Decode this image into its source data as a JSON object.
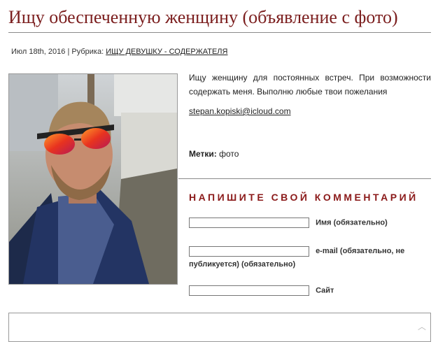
{
  "post": {
    "title": "Ищу обеспеченную женщину (объявление с фото)",
    "date": "Июл 18th, 2016",
    "separator": "|",
    "category_label": "Рубрика:",
    "category_link": "ИЩУ ДЕВУШКУ - СОДЕРЖАТЕЛЯ",
    "body": "Ищу женщину для постоянных встреч. При возможности содержать меня. Выполню любые твои пожелания",
    "email": "stepan.kopiski@icloud.com",
    "tags_label": "Метки:",
    "tags": "фото"
  },
  "comments": {
    "heading": "НАПИШИТЕ СВОЙ КОММЕНТАРИЙ",
    "name_label": "Имя (обязательно)",
    "email_label": "e-mail (обязательно, не публикуется) (обязательно)",
    "site_label": "Сайт"
  }
}
